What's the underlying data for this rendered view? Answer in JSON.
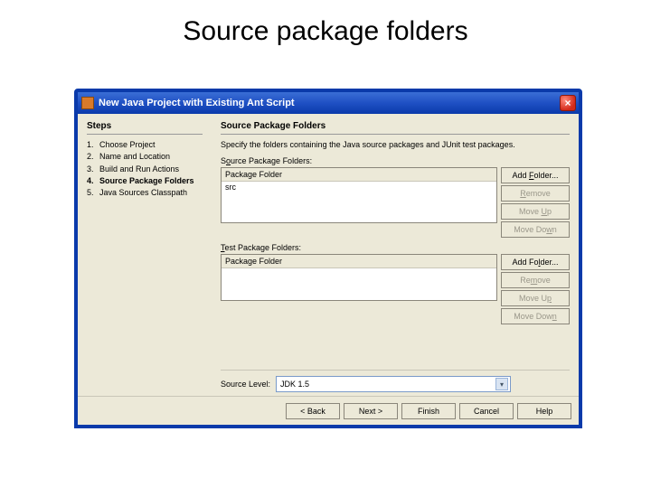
{
  "slide": {
    "title": "Source package folders"
  },
  "window": {
    "title": "New Java Project with Existing Ant Script"
  },
  "sidebar": {
    "heading": "Steps",
    "items": [
      {
        "num": "1.",
        "label": "Choose Project"
      },
      {
        "num": "2.",
        "label": "Name and Location"
      },
      {
        "num": "3.",
        "label": "Build and Run Actions"
      },
      {
        "num": "4.",
        "label": "Source Package Folders"
      },
      {
        "num": "5.",
        "label": "Java Sources Classpath"
      }
    ],
    "active_index": 3
  },
  "main": {
    "heading": "Source Package Folders",
    "instruction": "Specify the folders containing the Java source packages and JUnit test packages.",
    "source": {
      "label_pre": "S",
      "label_ul": "o",
      "label_post": "urce Package Folders:",
      "header": "Package Folder",
      "rows": [
        "src"
      ],
      "buttons": {
        "add_pre": "Add ",
        "add_ul": "F",
        "add_post": "older...",
        "remove_ul": "R",
        "remove_post": "emove",
        "moveup_pre": "Move ",
        "moveup_ul": "U",
        "moveup_post": "p",
        "movedown_pre": "Move Do",
        "movedown_ul": "w",
        "movedown_post": "n"
      }
    },
    "test": {
      "label_ul": "T",
      "label_post": "est Package Folders:",
      "header": "Package Folder",
      "buttons": {
        "add_pre": "Add Fo",
        "add_ul": "l",
        "add_post": "der...",
        "remove_pre": "Re",
        "remove_ul": "m",
        "remove_post": "ove",
        "moveup_pre": "Move U",
        "moveup_ul": "p",
        "moveup_post": "",
        "movedown_pre": "Move Dow",
        "movedown_ul": "n",
        "movedown_post": ""
      }
    },
    "source_level": {
      "label": "Source Level:",
      "value": "JDK 1.5"
    }
  },
  "footer": {
    "back": "< Back",
    "next": "Next >",
    "finish": "Finish",
    "cancel": "Cancel",
    "help": "Help"
  }
}
